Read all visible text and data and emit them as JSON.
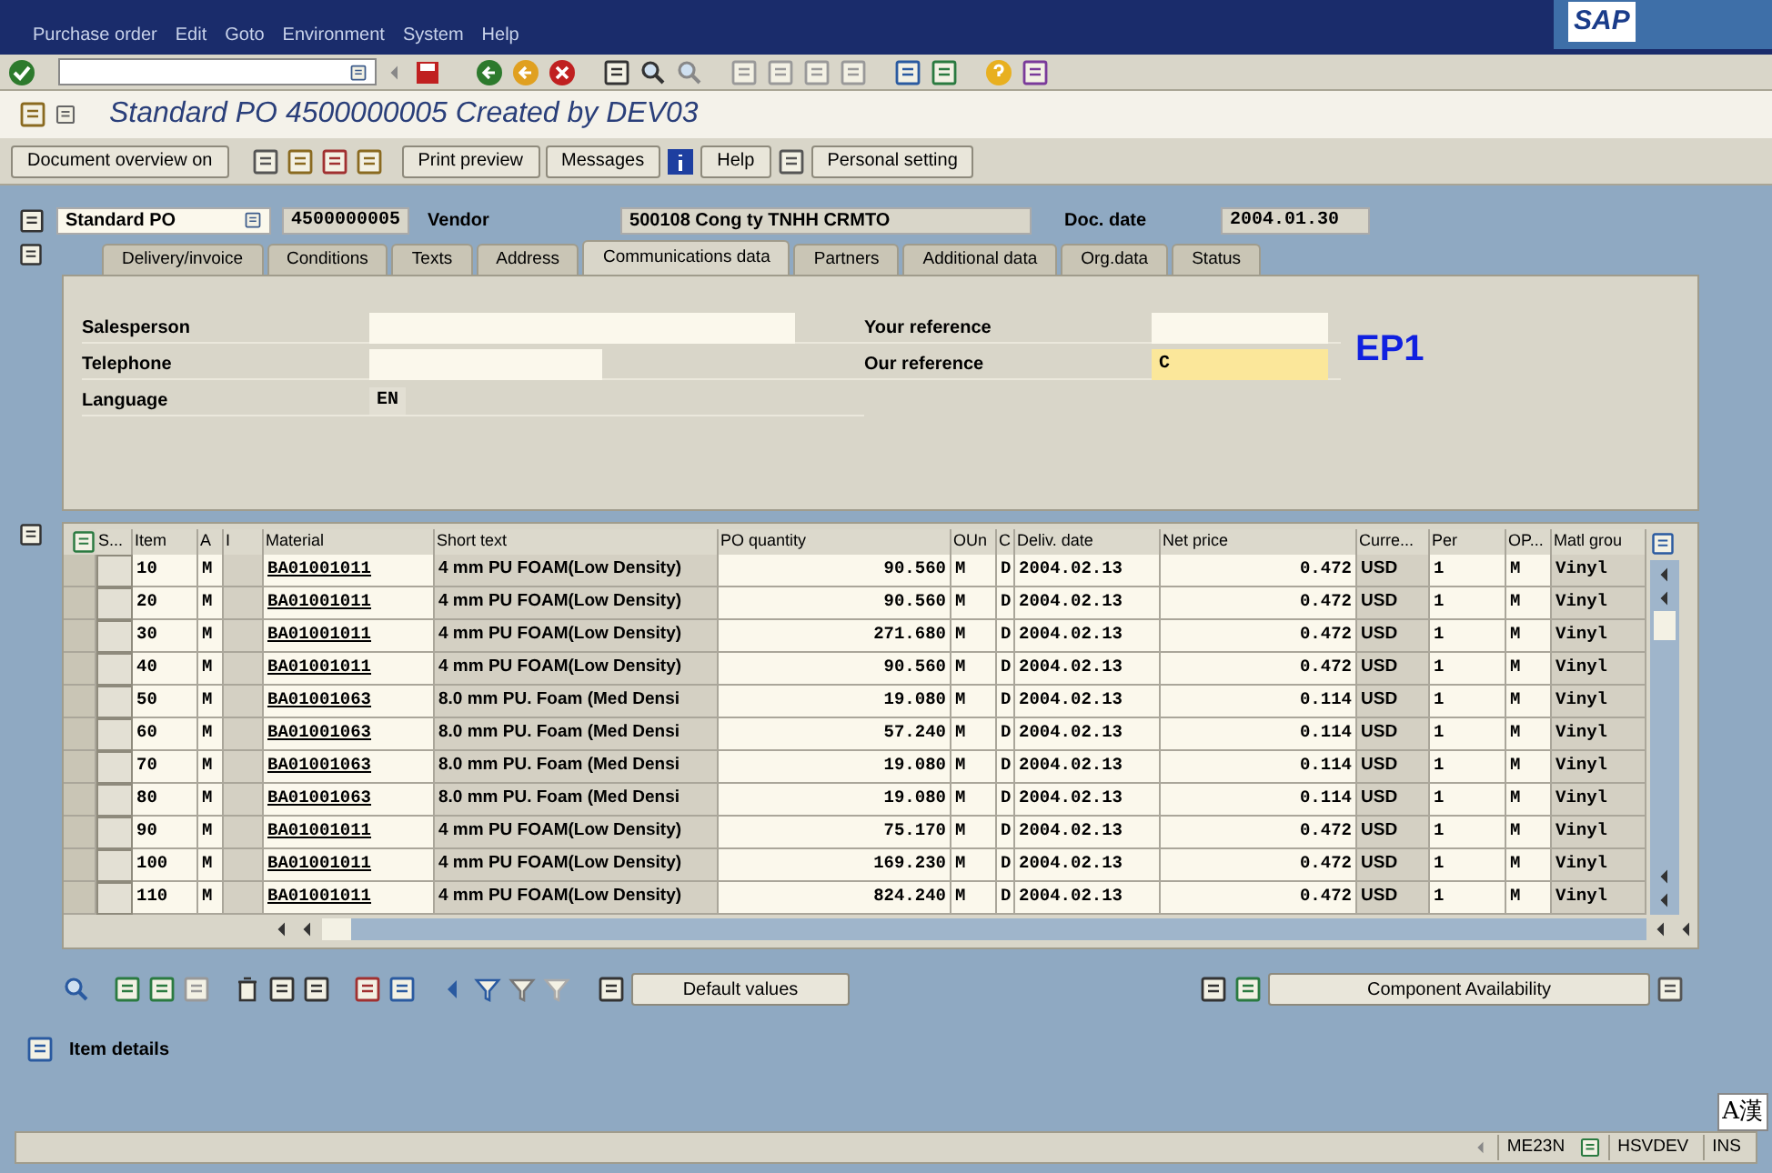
{
  "menu_bar": [
    "Purchase order",
    "Edit",
    "Goto",
    "Environment",
    "System",
    "Help"
  ],
  "logo": "SAP",
  "title": "Standard PO 4500000005 Created by DEV03",
  "app_toolbar": {
    "document_overview": "Document overview on",
    "print_preview": "Print preview",
    "messages": "Messages",
    "help": "Help",
    "personal_setting": "Personal setting"
  },
  "header": {
    "doc_type": "Standard PO",
    "po_number": "4500000005",
    "vendor_label": "Vendor",
    "vendor": "500108 Cong ty TNHH CRMTO",
    "doc_date_label": "Doc. date",
    "doc_date": "2004.01.30"
  },
  "tabs": [
    {
      "label": "Delivery/invoice",
      "selected": false
    },
    {
      "label": "Conditions",
      "selected": false
    },
    {
      "label": "Texts",
      "selected": false
    },
    {
      "label": "Address",
      "selected": false
    },
    {
      "label": "Communications data",
      "selected": true
    },
    {
      "label": "Partners",
      "selected": false
    },
    {
      "label": "Additional data",
      "selected": false
    },
    {
      "label": "Org.data",
      "selected": false
    },
    {
      "label": "Status",
      "selected": false
    }
  ],
  "fields_left": [
    {
      "label": "Salesperson",
      "kind": "wide"
    },
    {
      "label": "Telephone",
      "kind": "medium"
    },
    {
      "label": "Language",
      "value": "EN",
      "kind": "display"
    }
  ],
  "fields_right": [
    {
      "label": "Your reference",
      "focused": false
    },
    {
      "label": "Our reference",
      "value": "C",
      "focused": true
    }
  ],
  "system_label": "EP1",
  "table": {
    "columns": [
      "S...",
      "Item",
      "A",
      "I",
      "Material",
      "Short text",
      "PO quantity",
      "OUn",
      "C",
      "Deliv. date",
      "Net price",
      "Curre...",
      "Per",
      "OP...",
      "Matl grou"
    ],
    "rows": [
      {
        "cells": [
          "",
          "10",
          "M",
          "",
          "BA01001011",
          "4 mm PU FOAM(Low Density)",
          "90.560",
          "M",
          "D",
          "2004.02.13",
          "0.472",
          "USD",
          "1",
          "M",
          "Vinyl"
        ]
      },
      {
        "cells": [
          "",
          "20",
          "M",
          "",
          "BA01001011",
          "4 mm PU FOAM(Low Density)",
          "90.560",
          "M",
          "D",
          "2004.02.13",
          "0.472",
          "USD",
          "1",
          "M",
          "Vinyl"
        ]
      },
      {
        "cells": [
          "",
          "30",
          "M",
          "",
          "BA01001011",
          "4 mm PU FOAM(Low Density)",
          "271.680",
          "M",
          "D",
          "2004.02.13",
          "0.472",
          "USD",
          "1",
          "M",
          "Vinyl"
        ]
      },
      {
        "cells": [
          "",
          "40",
          "M",
          "",
          "BA01001011",
          "4 mm PU FOAM(Low Density)",
          "90.560",
          "M",
          "D",
          "2004.02.13",
          "0.472",
          "USD",
          "1",
          "M",
          "Vinyl"
        ]
      },
      {
        "cells": [
          "",
          "50",
          "M",
          "",
          "BA01001063",
          "8.0 mm PU. Foam (Med Densi",
          "19.080",
          "M",
          "D",
          "2004.02.13",
          "0.114",
          "USD",
          "1",
          "M",
          "Vinyl"
        ]
      },
      {
        "cells": [
          "",
          "60",
          "M",
          "",
          "BA01001063",
          "8.0 mm PU. Foam (Med Densi",
          "57.240",
          "M",
          "D",
          "2004.02.13",
          "0.114",
          "USD",
          "1",
          "M",
          "Vinyl"
        ]
      },
      {
        "cells": [
          "",
          "70",
          "M",
          "",
          "BA01001063",
          "8.0 mm PU. Foam (Med Densi",
          "19.080",
          "M",
          "D",
          "2004.02.13",
          "0.114",
          "USD",
          "1",
          "M",
          "Vinyl"
        ]
      },
      {
        "cells": [
          "",
          "80",
          "M",
          "",
          "BA01001063",
          "8.0 mm PU. Foam (Med Densi",
          "19.080",
          "M",
          "D",
          "2004.02.13",
          "0.114",
          "USD",
          "1",
          "M",
          "Vinyl"
        ]
      },
      {
        "cells": [
          "",
          "90",
          "M",
          "",
          "BA01001011",
          "4 mm PU FOAM(Low Density)",
          "75.170",
          "M",
          "D",
          "2004.02.13",
          "0.472",
          "USD",
          "1",
          "M",
          "Vinyl"
        ]
      },
      {
        "cells": [
          "",
          "100",
          "M",
          "",
          "BA01001011",
          "4 mm PU FOAM(Low Density)",
          "169.230",
          "M",
          "D",
          "2004.02.13",
          "0.472",
          "USD",
          "1",
          "M",
          "Vinyl"
        ]
      },
      {
        "cells": [
          "",
          "110",
          "M",
          "",
          "BA01001011",
          "4 mm PU FOAM(Low Density)",
          "824.240",
          "M",
          "D",
          "2004.02.13",
          "0.472",
          "USD",
          "1",
          "M",
          "Vinyl"
        ]
      }
    ]
  },
  "bottom_buttons": {
    "default_values": "Default values",
    "component_availability": "Component Availability"
  },
  "item_details": "Item details",
  "status_bar": {
    "transaction": "ME23N",
    "server": "HSVDEV",
    "mode": "INS"
  },
  "ime": "A漢"
}
